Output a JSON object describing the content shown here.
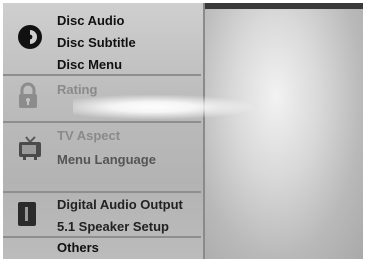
{
  "menu": {
    "groups": [
      {
        "icon": "disc-icon",
        "items": [
          {
            "label": "Disc Audio",
            "enabled": true
          },
          {
            "label": "Disc Subtitle",
            "enabled": true
          },
          {
            "label": "Disc Menu",
            "enabled": true
          }
        ]
      },
      {
        "icon": "padlock-icon",
        "items": [
          {
            "label": "Rating",
            "enabled": false
          }
        ]
      },
      {
        "icon": "tv-icon",
        "items": [
          {
            "label": "TV Aspect",
            "enabled": false
          },
          {
            "label": "Menu Language",
            "enabled": false
          }
        ]
      },
      {
        "icon": "speaker-icon",
        "items": [
          {
            "label": "Digital Audio Output",
            "enabled": true
          },
          {
            "label": "5.1 Speaker Setup",
            "enabled": true
          },
          {
            "label": "Others",
            "enabled": true
          }
        ]
      }
    ]
  },
  "colors": {
    "panel": "#c4c4c4",
    "text": "#111111",
    "dim_text": "#8a8a8a",
    "screen_bg": "#2a2a2a"
  }
}
